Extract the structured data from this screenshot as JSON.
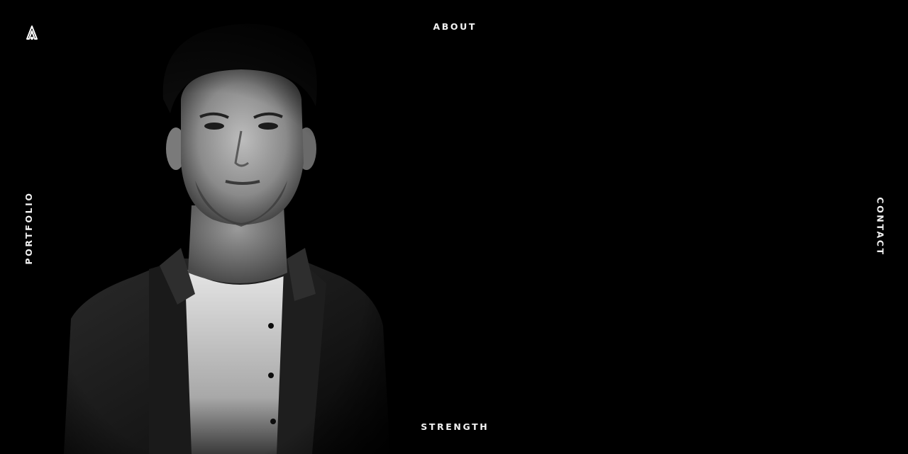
{
  "brand": {
    "logo_icon": "rocket-a-logo-icon"
  },
  "nav": {
    "top_label": "ABOUT",
    "bottom_label": "STRENGTH",
    "left_label": "PORTFOLIO",
    "right_label": "CONTACT"
  },
  "hero": {
    "image_icon": "portrait-photo",
    "background_color": "#000000",
    "text_color": "#f2f2f2"
  }
}
